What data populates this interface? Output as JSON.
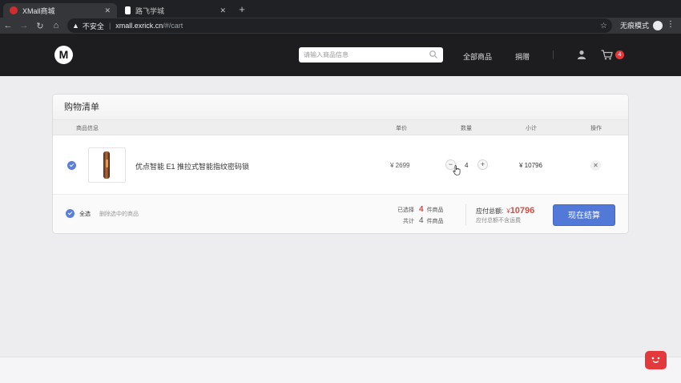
{
  "browser": {
    "tabs": [
      {
        "title": "XMall商城",
        "active": true
      },
      {
        "title": "路飞学城",
        "active": false
      }
    ],
    "security_label": "不安全",
    "url_host": "xmall.exrick.cn",
    "url_path": "/#/cart",
    "incognito_label": "无痕模式"
  },
  "header": {
    "logo_letter": "M",
    "search_placeholder": "请输入商品信息",
    "nav": [
      "全部商品",
      "捐赠"
    ],
    "cart_count": "4"
  },
  "cart": {
    "title": "购物清单",
    "columns": {
      "info": "商品信息",
      "price": "单价",
      "qty": "数量",
      "subtotal": "小计",
      "action": "操作"
    },
    "items": [
      {
        "name": "优点智能 E1 推拉式智能指纹密码锁",
        "price": "¥ 2699",
        "qty": "4",
        "subtotal": "¥ 10796",
        "checked": true
      }
    ],
    "footer": {
      "select_all": "全选",
      "delete_selected": "删除选中的商品",
      "selected_prefix": "已选择",
      "selected_count": "4",
      "selected_suffix": "件商品",
      "total_prefix": "共计",
      "total_count": "4",
      "total_suffix": "件商品",
      "payable_label": "应付总额:",
      "payable_currency": "¥",
      "payable_value": "10796",
      "payable_note": "应付总额不含运费",
      "checkout_label": "现在结算"
    }
  },
  "colors": {
    "accent": "#5278d8",
    "price_red": "#d44d44",
    "header_bg": "#1d1d1f",
    "badge_red": "#e4393c"
  }
}
